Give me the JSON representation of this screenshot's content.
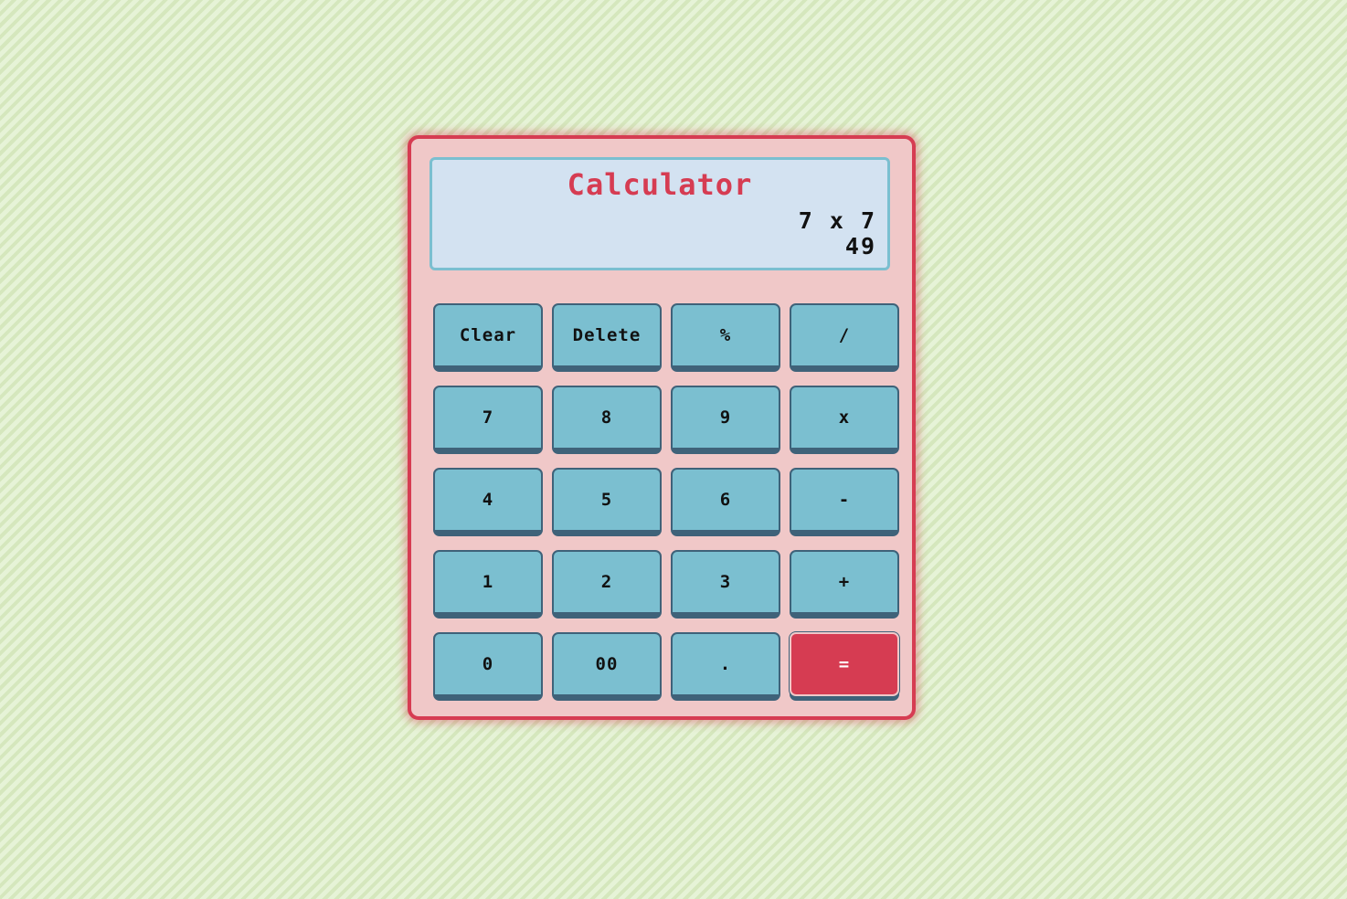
{
  "calculator": {
    "title": "Calculator",
    "expression": "7 x 7",
    "result": "49"
  },
  "keys": [
    {
      "label": "Clear",
      "name": "clear-button"
    },
    {
      "label": "Delete",
      "name": "delete-button"
    },
    {
      "label": "%",
      "name": "percent-button"
    },
    {
      "label": "/",
      "name": "divide-button"
    },
    {
      "label": "7",
      "name": "digit-7-button"
    },
    {
      "label": "8",
      "name": "digit-8-button"
    },
    {
      "label": "9",
      "name": "digit-9-button"
    },
    {
      "label": "x",
      "name": "multiply-button"
    },
    {
      "label": "4",
      "name": "digit-4-button"
    },
    {
      "label": "5",
      "name": "digit-5-button"
    },
    {
      "label": "6",
      "name": "digit-6-button"
    },
    {
      "label": "-",
      "name": "subtract-button"
    },
    {
      "label": "1",
      "name": "digit-1-button"
    },
    {
      "label": "2",
      "name": "digit-2-button"
    },
    {
      "label": "3",
      "name": "digit-3-button"
    },
    {
      "label": "+",
      "name": "add-button"
    },
    {
      "label": "0",
      "name": "digit-0-button"
    },
    {
      "label": "00",
      "name": "double-zero-button"
    },
    {
      "label": ".",
      "name": "decimal-button"
    },
    {
      "label": "=",
      "name": "equals-button"
    }
  ],
  "colors": {
    "accent": "#d63c52",
    "key": "#7bbfd0",
    "key_shadow": "#3f6279",
    "body": "#f0c8c8",
    "display": "#d3e2f1"
  }
}
